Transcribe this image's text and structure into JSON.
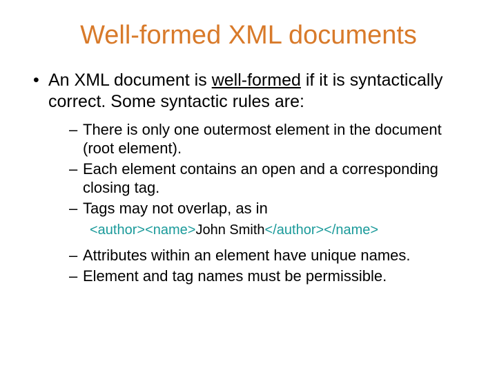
{
  "title": "Well-formed XML documents",
  "bullet": {
    "pre": "An XML document is ",
    "underlined": "well-formed",
    "post": " if it is syntactically correct. Some syntactic rules are:"
  },
  "sub": [
    "There is only one outermost element in the document (root element).",
    "Each element contains an open and a corresponding closing tag.",
    "Tags may not overlap, as in",
    "Attributes within an element have unique names.",
    "Element and tag names must be permissible."
  ],
  "code": {
    "t1": "<author>",
    "t2": "<name>",
    "txt": "John Smith",
    "t3": "</author>",
    "t4": "</name>"
  }
}
